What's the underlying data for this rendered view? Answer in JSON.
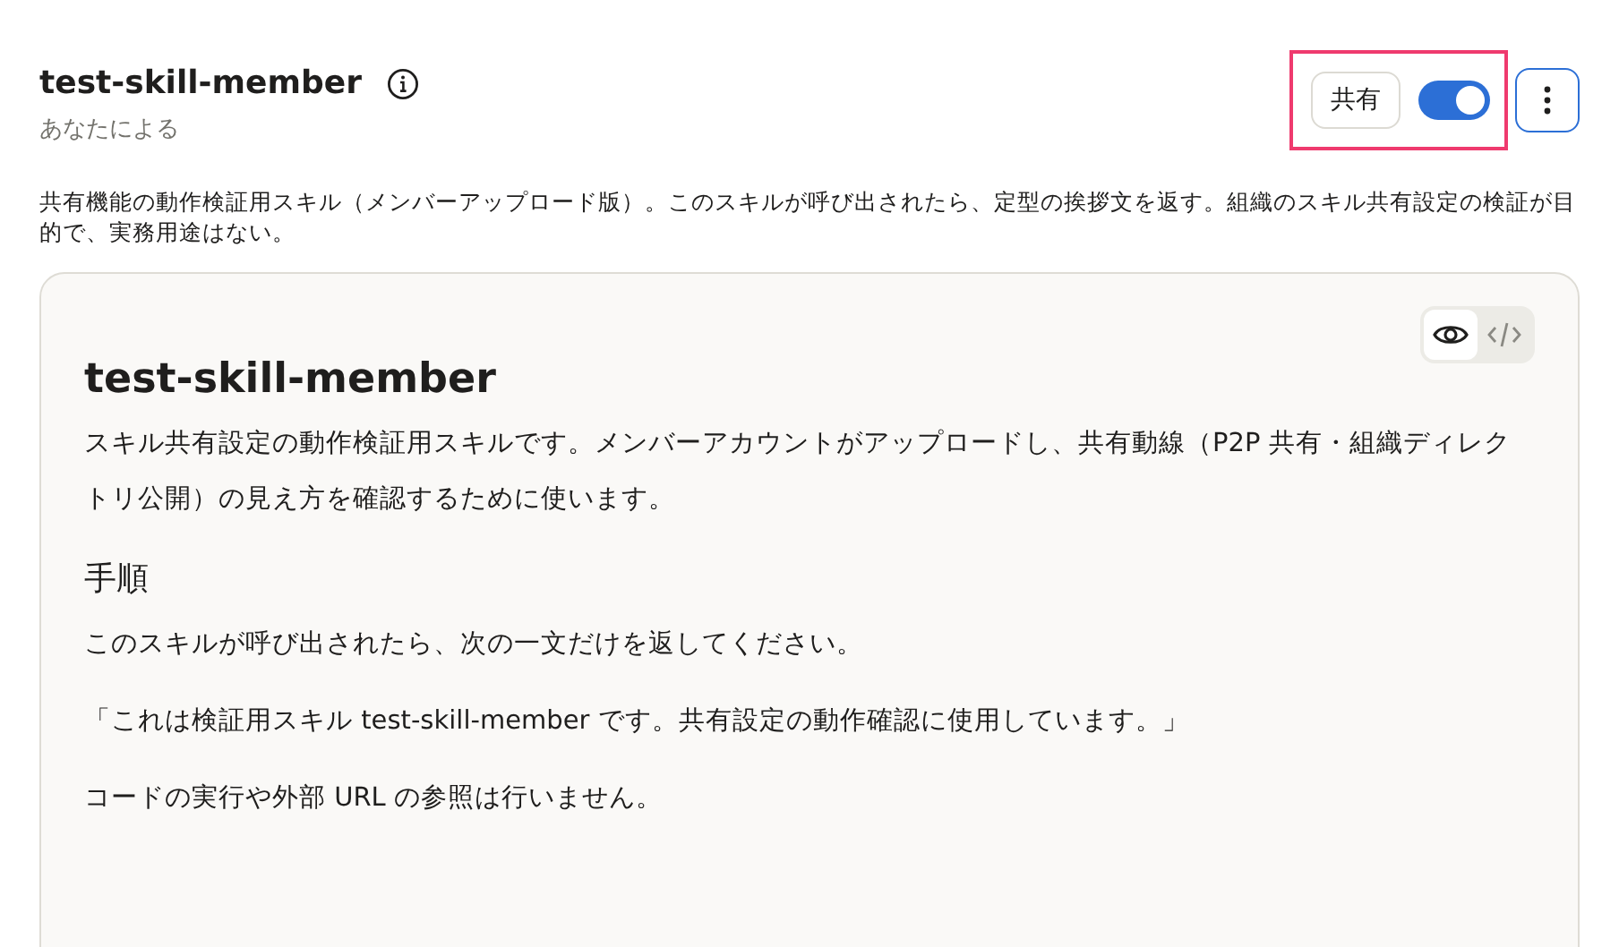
{
  "header": {
    "title": "test-skill-member",
    "subtitle": "あなたによる"
  },
  "share": {
    "label": "共有",
    "on": true,
    "highlighted": true
  },
  "description": "共有機能の動作検証用スキル（メンバーアップロード版）。このスキルが呼び出されたら、定型の挨拶文を返す。組織のスキル共有設定の検証が目的で、実務用途はない。",
  "view_modes": [
    {
      "kind": "preview",
      "selected": true
    },
    {
      "kind": "code",
      "selected": false
    }
  ],
  "document": {
    "title": "test-skill-member",
    "intro": "スキル共有設定の動作検証用スキルです。メンバーアカウントがアップロードし、共有動線（P2P 共有・組織ディレクトリ公開）の見え方を確認するために使います。",
    "section_heading": "手順",
    "paragraphs": [
      "このスキルが呼び出されたら、次の一文だけを返してください。",
      "「これは検証用スキル test-skill-member です。共有設定の動作確認に使用しています。」",
      "コードの実行や外部 URL の参照は行いません。"
    ]
  }
}
